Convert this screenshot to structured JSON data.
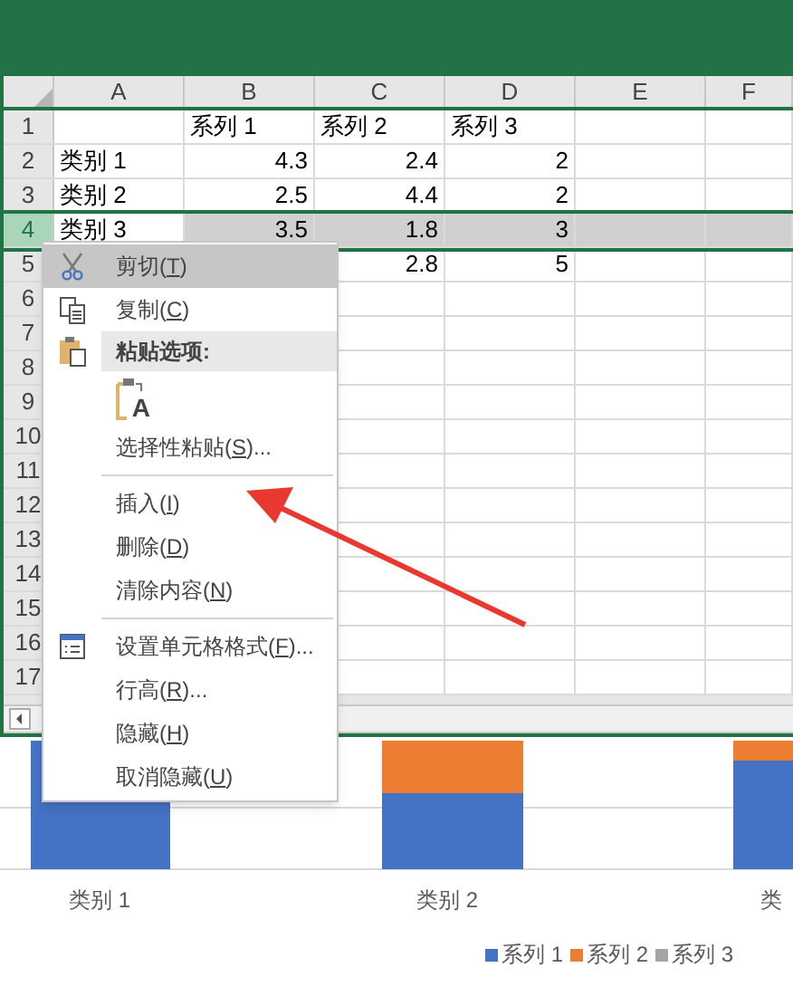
{
  "sheet": {
    "columns": [
      {
        "label": "A",
        "selected": false
      },
      {
        "label": "B",
        "selected": false
      },
      {
        "label": "C",
        "selected": false
      },
      {
        "label": "D",
        "selected": false
      },
      {
        "label": "E",
        "selected": false
      },
      {
        "label": "F",
        "selected": false
      }
    ],
    "rows": [
      {
        "number": "1",
        "selected": false,
        "cells": [
          "",
          "系列 1",
          "系列 2",
          "系列 3",
          "",
          ""
        ]
      },
      {
        "number": "2",
        "selected": false,
        "cells": [
          "类别 1",
          "4.3",
          "2.4",
          "2",
          "",
          ""
        ]
      },
      {
        "number": "3",
        "selected": false,
        "cells": [
          "类别 2",
          "2.5",
          "4.4",
          "2",
          "",
          ""
        ]
      },
      {
        "number": "4",
        "selected": true,
        "cells": [
          "类别 3",
          "3.5",
          "1.8",
          "3",
          "",
          ""
        ]
      },
      {
        "number": "5",
        "selected": false,
        "cells": [
          "",
          "",
          "2.8",
          "5",
          "",
          ""
        ]
      },
      {
        "number": "6",
        "selected": false,
        "cells": [
          "",
          "",
          "",
          "",
          "",
          ""
        ]
      },
      {
        "number": "7",
        "selected": false,
        "cells": [
          "",
          "",
          "",
          "",
          "",
          ""
        ]
      },
      {
        "number": "8",
        "selected": false,
        "cells": [
          "",
          "",
          "",
          "",
          "",
          ""
        ]
      },
      {
        "number": "9",
        "selected": false,
        "cells": [
          "",
          "",
          "",
          "",
          "",
          ""
        ]
      },
      {
        "number": "10",
        "selected": false,
        "cells": [
          "",
          "",
          "",
          "",
          "",
          ""
        ]
      },
      {
        "number": "11",
        "selected": false,
        "cells": [
          "",
          "",
          "",
          "",
          "",
          ""
        ]
      },
      {
        "number": "12",
        "selected": false,
        "cells": [
          "",
          "",
          "",
          "",
          "",
          ""
        ]
      },
      {
        "number": "13",
        "selected": false,
        "cells": [
          "",
          "",
          "",
          "",
          "",
          ""
        ]
      },
      {
        "number": "14",
        "selected": false,
        "cells": [
          "",
          "",
          "",
          "",
          "",
          ""
        ]
      },
      {
        "number": "15",
        "selected": false,
        "cells": [
          "",
          "",
          "",
          "",
          "",
          ""
        ]
      },
      {
        "number": "16",
        "selected": false,
        "cells": [
          "",
          "",
          "",
          "",
          "",
          ""
        ]
      },
      {
        "number": "17",
        "selected": false,
        "cells": [
          "",
          "",
          "",
          "",
          "",
          ""
        ]
      }
    ]
  },
  "context_menu": [
    {
      "kind": "cut",
      "label": "剪切(",
      "key": "T",
      "tail": ")",
      "selected": true,
      "separator_before": false
    },
    {
      "kind": "copy",
      "label": "复制(",
      "key": "C",
      "tail": ")",
      "selected": false,
      "separator_before": false
    },
    {
      "kind": "header",
      "label": "粘贴选项:",
      "selected": false,
      "separator_before": false
    },
    {
      "kind": "paste_option",
      "glyph": "A",
      "selected": false,
      "separator_before": false
    },
    {
      "kind": "plain",
      "label": "选择性粘贴(",
      "key": "S",
      "tail": ")...",
      "selected": false,
      "separator_before": false
    },
    {
      "kind": "plain",
      "label": "插入(",
      "key": "I",
      "tail": ")",
      "selected": false,
      "separator_before": true
    },
    {
      "kind": "plain",
      "label": "删除(",
      "key": "D",
      "tail": ")",
      "selected": false,
      "separator_before": false
    },
    {
      "kind": "plain",
      "label": "清除内容(",
      "key": "N",
      "tail": ")",
      "selected": false,
      "separator_before": false
    },
    {
      "kind": "format",
      "label": "设置单元格格式(",
      "key": "F",
      "tail": ")...",
      "selected": false,
      "separator_before": true
    },
    {
      "kind": "plain",
      "label": "行高(",
      "key": "R",
      "tail": ")...",
      "selected": false,
      "separator_before": false
    },
    {
      "kind": "plain",
      "label": "隐藏(",
      "key": "H",
      "tail": ")",
      "selected": false,
      "separator_before": false
    },
    {
      "kind": "plain",
      "label": "取消隐藏(",
      "key": "U",
      "tail": ")",
      "selected": false,
      "separator_before": false
    }
  ],
  "chart": {
    "categories": [
      "类别 1",
      "类别 2",
      "类"
    ],
    "legend": [
      {
        "name": "系列 1",
        "color": "#4472c4"
      },
      {
        "name": "系列 2",
        "color": "#ed7d31"
      },
      {
        "name": "系列 3",
        "color": "#a5a5a5"
      }
    ]
  }
}
